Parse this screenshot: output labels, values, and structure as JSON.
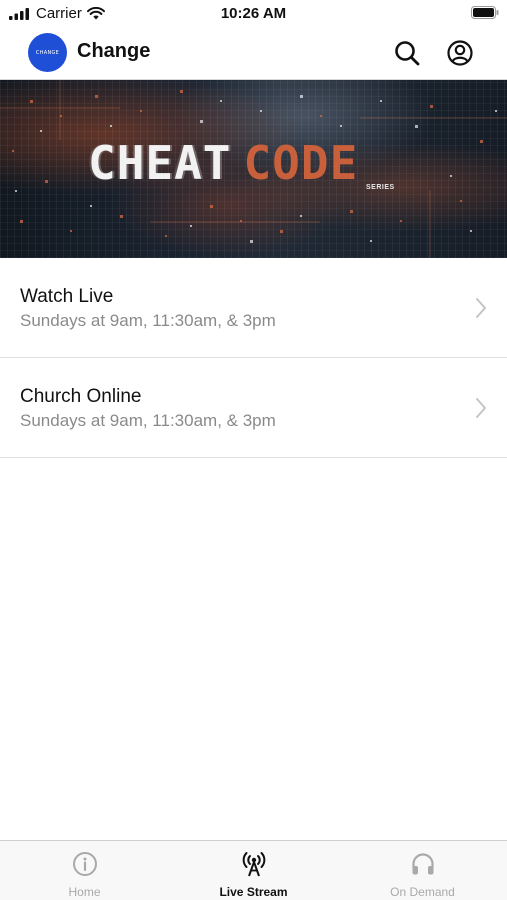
{
  "status_bar": {
    "carrier": "Carrier",
    "time": "10:26 AM"
  },
  "header": {
    "logo_text": "CHANGE",
    "title": "Change",
    "search_icon": "search-icon",
    "account_icon": "account-icon"
  },
  "banner": {
    "word1": "CHEAT",
    "word2": "CODE",
    "subword": "SERIES",
    "accent_color": "#c8603c"
  },
  "list": {
    "items": [
      {
        "title": "Watch Live",
        "subtitle": "Sundays at 9am, 11:30am, & 3pm"
      },
      {
        "title": "Church Online",
        "subtitle": "Sundays at 9am, 11:30am, & 3pm"
      }
    ]
  },
  "tab_bar": {
    "tabs": [
      {
        "label": "Home",
        "icon": "info-icon",
        "active": false
      },
      {
        "label": "Live Stream",
        "icon": "broadcast-icon",
        "active": true
      },
      {
        "label": "On Demand",
        "icon": "headphones-icon",
        "active": false
      }
    ]
  },
  "colors": {
    "logo_blue": "#1f4fd6",
    "inactive_tab": "#a9a9a9",
    "subtitle_gray": "#8a8a8a"
  }
}
